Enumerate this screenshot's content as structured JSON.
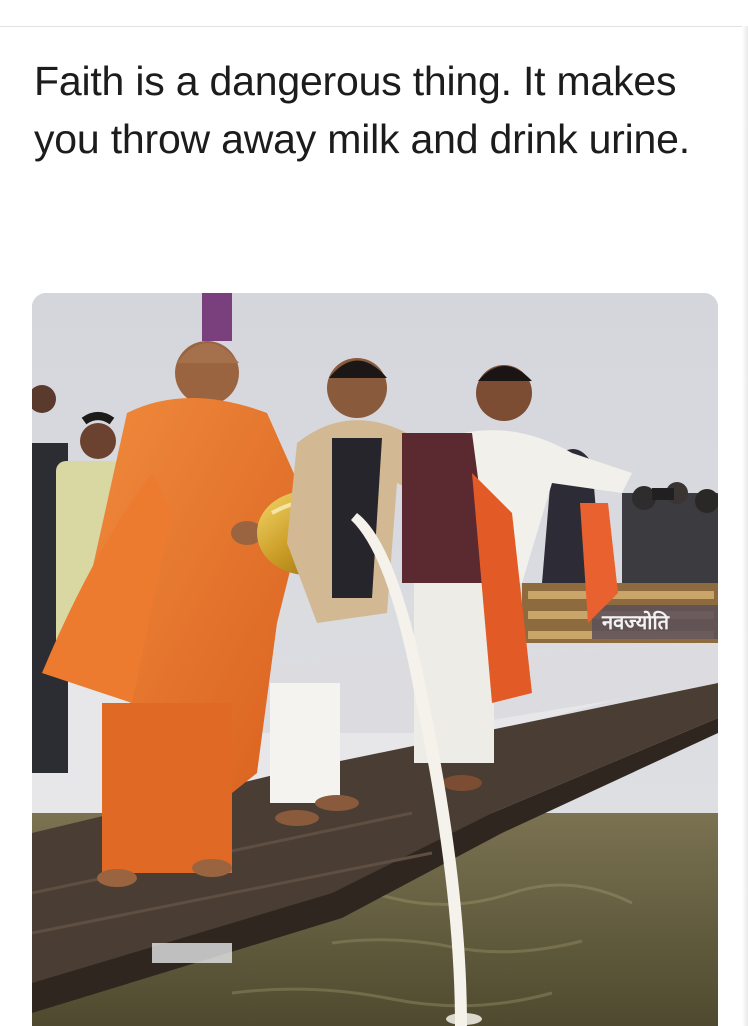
{
  "post": {
    "caption": "Faith is a dangerous thing. It makes you throw away milk and drink urine.",
    "photo": {
      "banner_text": "नवज्योति"
    }
  },
  "colors": {
    "background": "#ffffff",
    "caption_text": "#1c1c1c",
    "saffron_robe": "#e8732a",
    "milk": "#f4f2ea",
    "river": "#6b6540",
    "deck": "#4a3d33"
  }
}
